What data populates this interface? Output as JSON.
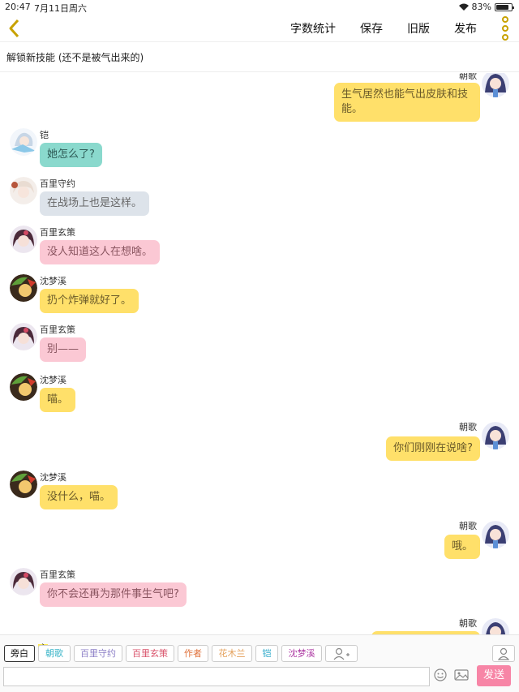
{
  "status": {
    "time": "20:47",
    "date": "7月11日周六",
    "battery": "83%"
  },
  "nav": {
    "actions": [
      "字数统计",
      "保存",
      "旧版",
      "发布"
    ]
  },
  "title": "解锁新技能 (还不是被气出来的)",
  "messages": [
    {
      "side": "right",
      "name": "朝歌",
      "text": "生气居然也能气出皮肤和技能。",
      "color": "yellow"
    },
    {
      "side": "left",
      "name": "铠",
      "text": "她怎么了?",
      "color": "teal"
    },
    {
      "side": "left",
      "name": "百里守约",
      "text": "在战场上也是这样。",
      "color": "grey"
    },
    {
      "side": "left",
      "name": "百里玄策",
      "text": "没人知道这人在想啥。",
      "color": "pink"
    },
    {
      "side": "left",
      "name": "沈梦溪",
      "text": "扔个炸弹就好了。",
      "color": "yellow"
    },
    {
      "side": "left",
      "name": "百里玄策",
      "text": "别——",
      "color": "pink"
    },
    {
      "side": "left",
      "name": "沈梦溪",
      "text": "喵。",
      "color": "yellow"
    },
    {
      "side": "right",
      "name": "朝歌",
      "text": "你们刚刚在说啥?",
      "color": "yellow"
    },
    {
      "side": "left",
      "name": "沈梦溪",
      "text": "没什么，喵。",
      "color": "yellow"
    },
    {
      "side": "right",
      "name": "朝歌",
      "text": "哦。",
      "color": "yellow"
    },
    {
      "side": "left",
      "name": "百里玄策",
      "text": "你不会还再为那件事生气吧?",
      "color": "pink"
    },
    {
      "side": "right",
      "name": "朝歌",
      "text": "",
      "color": "yellow"
    }
  ],
  "tags": {
    "narration": "旁白",
    "host_badge": "主",
    "characters": [
      {
        "label": "朝歌",
        "color": "#3db6c9"
      },
      {
        "label": "百里守约",
        "color": "#8c7fc7"
      },
      {
        "label": "百里玄策",
        "color": "#d9536b"
      },
      {
        "label": "作者",
        "color": "#e0723c"
      },
      {
        "label": "花木兰",
        "color": "#e4a05b"
      },
      {
        "label": "铠",
        "color": "#2aa8c9"
      },
      {
        "label": "沈梦溪",
        "color": "#b03fa6"
      }
    ]
  },
  "input": {
    "value": "",
    "send_label": "发送"
  },
  "colors": {
    "yellow": "#ffe06a",
    "teal": "#8ad9cd",
    "grey": "#dde3ea",
    "pink": "#fbc8d4",
    "accent": "#c8a200",
    "send": "#f785a6"
  }
}
